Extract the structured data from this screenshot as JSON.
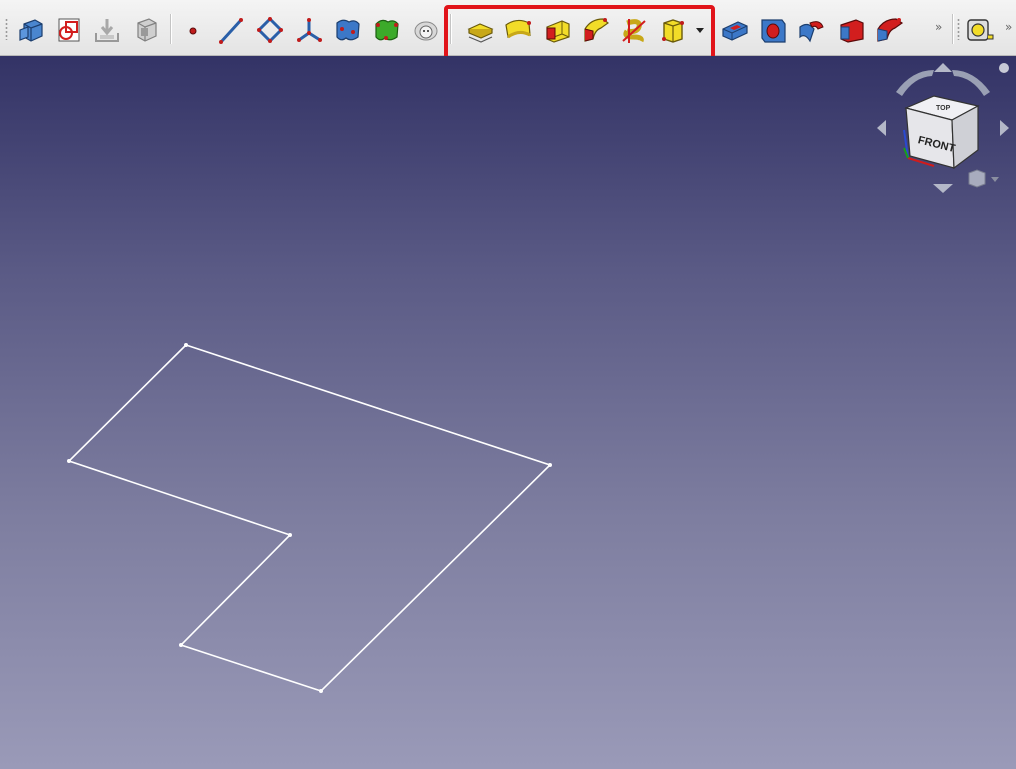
{
  "toolbar": {
    "groups": [
      {
        "name": "part-design-helpers",
        "tools": [
          "new-body-icon",
          "create-sketch-icon",
          "import-icon",
          "clone-icon"
        ]
      },
      {
        "name": "datum-tools",
        "tools": [
          "datum-point-icon",
          "datum-line-icon",
          "datum-plane-icon",
          "local-coordinate-system-icon",
          "shape-binder-icon",
          "subshape-binder-icon",
          "clone-sheep-icon"
        ]
      },
      {
        "name": "additive-features",
        "highlighted": true,
        "tools": [
          "pad-icon",
          "revolution-icon",
          "additive-loft-icon",
          "additive-pipe-icon",
          "additive-helix-icon",
          "additive-primitive-icon"
        ]
      },
      {
        "name": "subtractive-features",
        "tools": [
          "pocket-icon",
          "hole-icon",
          "groove-icon",
          "subtractive-loft-icon",
          "subtractive-pipe-icon"
        ]
      },
      {
        "name": "measurement",
        "tools": [
          "measure-icon"
        ]
      }
    ],
    "overflow_indicator": "»"
  },
  "viewport": {
    "background_top": "#333366",
    "background_bottom": "#9a9ab8",
    "sketch_color": "#ffffff",
    "sketch_shape": "l-shaped-closed-polyline"
  },
  "navigation_cube": {
    "face_label": "FRONT",
    "top_label": "TOP"
  },
  "colors": {
    "highlight_box": "#e1141a",
    "feature_yellow": "#f2dc28",
    "feature_red": "#d21e1e",
    "datum_blue": "#3c78c8"
  }
}
